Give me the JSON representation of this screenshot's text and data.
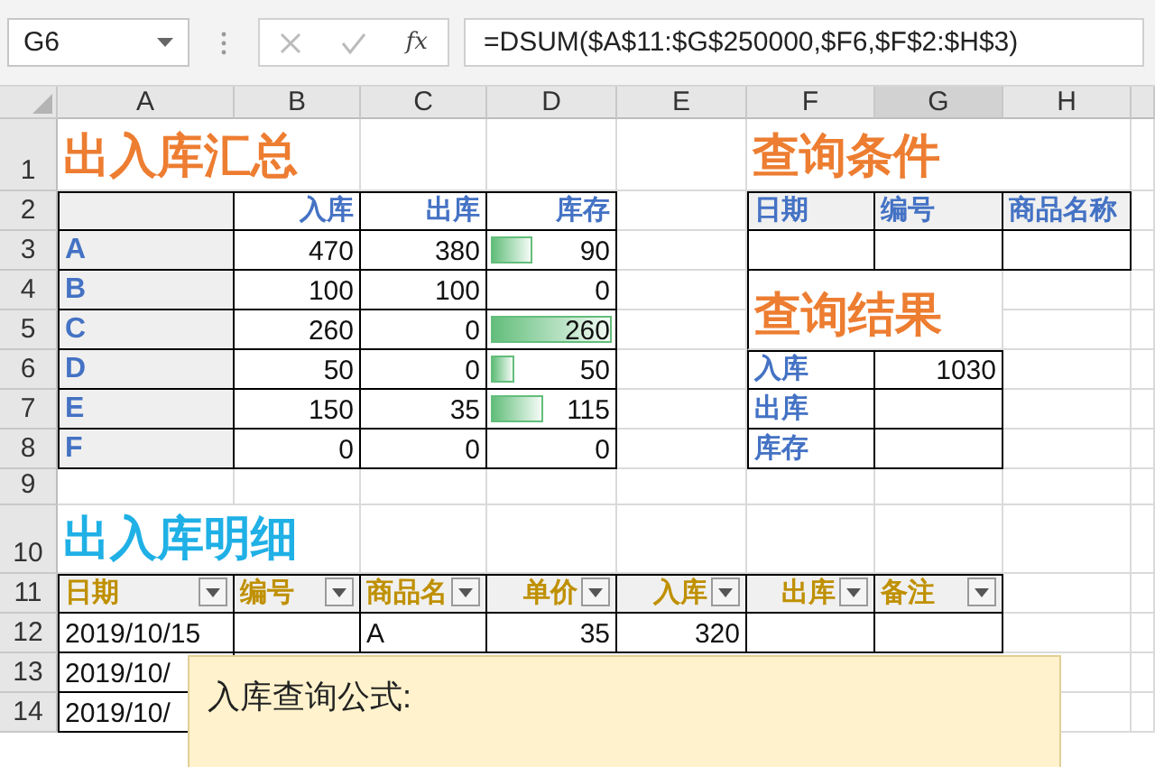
{
  "name_box": "G6",
  "function_button": "fx",
  "formula": "=DSUM($A$11:$G$250000,$F6,$F$2:$H$3)",
  "columns": [
    "A",
    "B",
    "C",
    "D",
    "E",
    "F",
    "G",
    "H"
  ],
  "rows": [
    "1",
    "2",
    "3",
    "4",
    "5",
    "6",
    "7",
    "8",
    "9",
    "10",
    "11",
    "12",
    "13",
    "14"
  ],
  "summary": {
    "title": "出入库汇总",
    "headers": [
      "入库",
      "出库",
      "库存"
    ],
    "items": [
      {
        "name": "A",
        "in": "470",
        "out": "380",
        "stock": "90",
        "level": 0.35
      },
      {
        "name": "B",
        "in": "100",
        "out": "100",
        "stock": "0"
      },
      {
        "name": "C",
        "in": "260",
        "out": "0",
        "stock": "260",
        "level": 1
      },
      {
        "name": "D",
        "in": "50",
        "out": "0",
        "stock": "50",
        "level": 0.19
      },
      {
        "name": "E",
        "in": "150",
        "out": "35",
        "stock": "115",
        "level": 0.44
      },
      {
        "name": "F",
        "in": "0",
        "out": "0",
        "stock": "0"
      }
    ]
  },
  "query": {
    "title": "查询条件",
    "headers": [
      "日期",
      "编号",
      "商品名称"
    ]
  },
  "result": {
    "title": "查询结果",
    "rows": [
      {
        "label": "入库",
        "value": "1030"
      },
      {
        "label": "出库"
      },
      {
        "label": "库存"
      }
    ]
  },
  "detail": {
    "title": "出入库明细",
    "columns": [
      {
        "label": "日期",
        "kind": "text"
      },
      {
        "label": "编号",
        "kind": "text"
      },
      {
        "label": "商品名",
        "kind": "text"
      },
      {
        "label": "单价",
        "kind": "number"
      },
      {
        "label": "入库",
        "kind": "number"
      },
      {
        "label": "出库",
        "kind": "number"
      },
      {
        "label": "备注",
        "kind": "text"
      }
    ],
    "rows": [
      {
        "cells": [
          "2019/10/15",
          null,
          "A",
          "35",
          "320",
          null,
          null
        ]
      },
      {
        "cells": [
          "2019/10/"
        ]
      },
      {
        "cells": [
          "2019/10/"
        ]
      }
    ]
  },
  "note": {
    "text": "入库查询公式:"
  }
}
